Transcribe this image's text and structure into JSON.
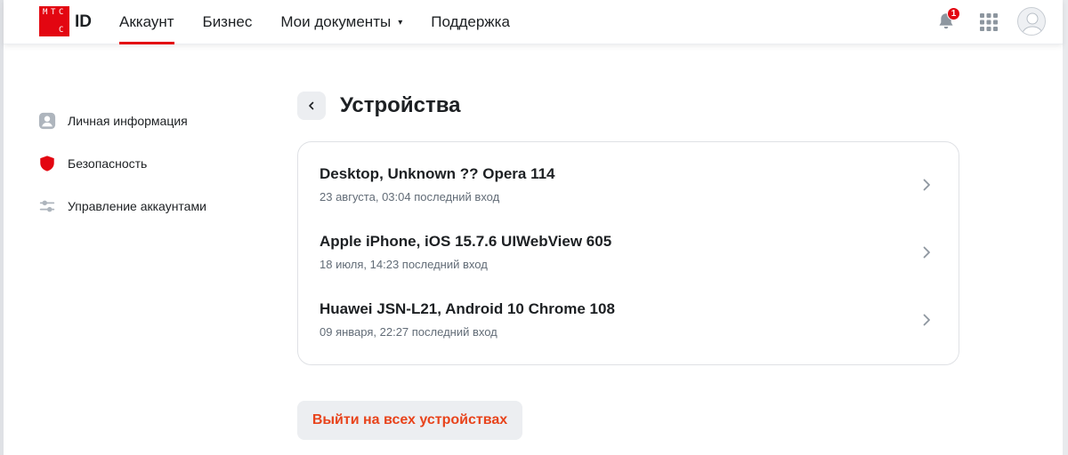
{
  "brand": {
    "logo_letters": [
      "М",
      "Т",
      "С",
      "С"
    ],
    "id_label": "ID",
    "accent_color": "#e30611"
  },
  "nav": {
    "items": [
      {
        "label": "Аккаунт",
        "active": true
      },
      {
        "label": "Бизнес",
        "active": false
      },
      {
        "label": "Мои документы",
        "active": false,
        "has_dropdown": true
      },
      {
        "label": "Поддержка",
        "active": false
      }
    ],
    "dropdown_icon": "▾"
  },
  "header_right": {
    "notification_count": "1",
    "icons": [
      "bell-icon",
      "apps-grid-icon",
      "avatar"
    ]
  },
  "sidebar": {
    "items": [
      {
        "label": "Личная информация",
        "icon": "user-profile-icon"
      },
      {
        "label": "Безопасность",
        "icon": "shield-icon"
      },
      {
        "label": "Управление аккаунтами",
        "icon": "sliders-icon"
      }
    ]
  },
  "main": {
    "title": "Устройства",
    "back_icon": "chevron-left-icon",
    "devices": [
      {
        "name": "Desktop, Unknown ?? Opera 114",
        "last_login": "23 августа, 03:04 последний вход"
      },
      {
        "name": "Apple iPhone, iOS 15.7.6 UIWebView 605",
        "last_login": "18 июля, 14:23 последний вход"
      },
      {
        "name": "Huawei JSN-L21, Android 10 Chrome 108",
        "last_login": "09 января, 22:27 последний вход"
      }
    ],
    "logout_all_label": "Выйти на всех устройствах",
    "logout_color": "#e8431b"
  }
}
